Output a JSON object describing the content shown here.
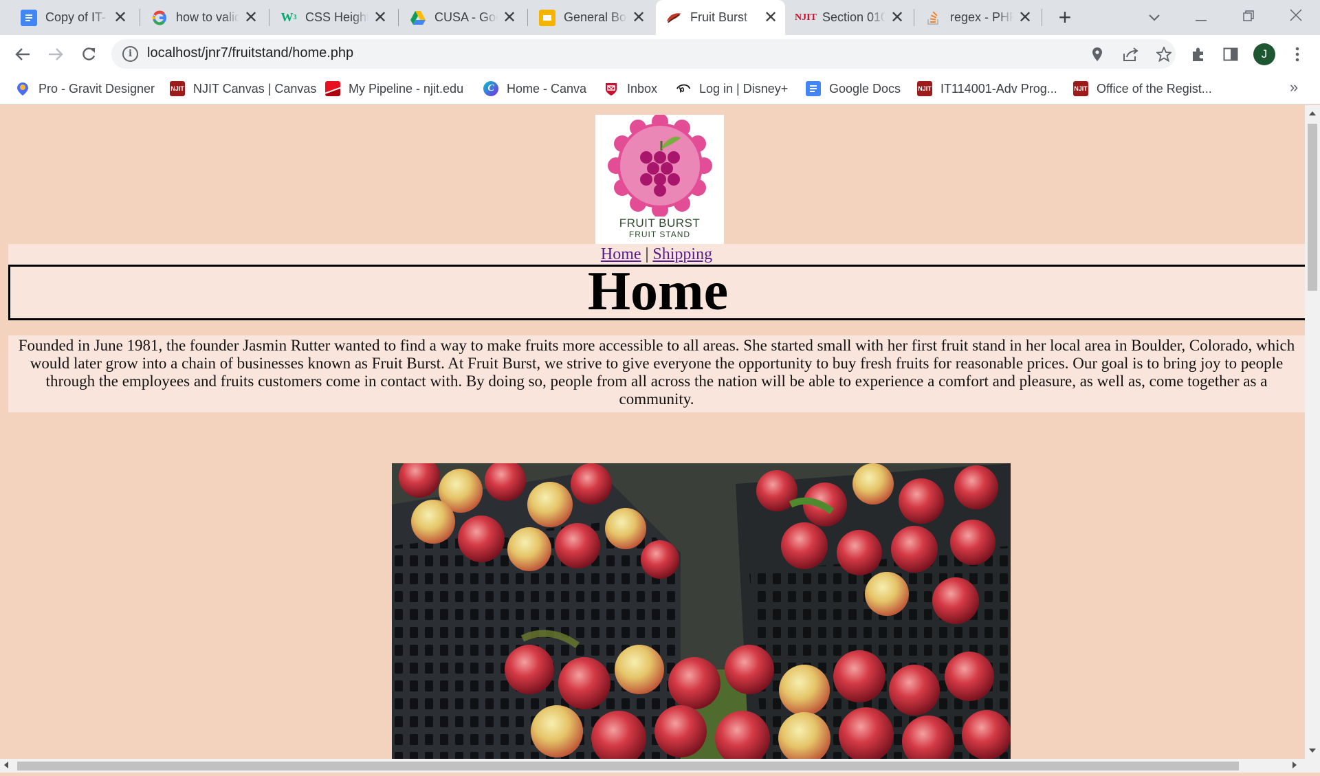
{
  "browser": {
    "tabs": [
      {
        "title": "Copy of IT-",
        "icon": "google-docs-icon",
        "active": false
      },
      {
        "title": "how to valid",
        "icon": "google-icon",
        "active": false
      },
      {
        "title": "CSS Height,",
        "icon": "w3schools-icon",
        "active": false
      },
      {
        "title": "CUSA - Goo",
        "icon": "google-drive-icon",
        "active": false
      },
      {
        "title": "General Boo",
        "icon": "google-slides-icon",
        "active": false
      },
      {
        "title": "Fruit Burst",
        "icon": "fruit-burst-icon",
        "active": true
      },
      {
        "title": "Section 010",
        "icon": "njit-icon",
        "active": false
      },
      {
        "title": "regex - PHP",
        "icon": "stack-overflow-icon",
        "active": false
      }
    ],
    "close_glyph": "✕",
    "new_tab_glyph": "+",
    "url": "localhost/jnr7/fruitstand/home.php",
    "profile_initial": "J",
    "bookmarks": [
      {
        "label": "Pro - Gravit Designer",
        "icon": "gravit-icon"
      },
      {
        "label": "NJIT Canvas | Canvas",
        "icon": "njit-icon"
      },
      {
        "label": "My Pipeline - njit.edu",
        "icon": "pipeline-icon"
      },
      {
        "label": "Home - Canva",
        "icon": "canva-icon"
      },
      {
        "label": "Inbox",
        "icon": "mail-icon"
      },
      {
        "label": "Log in | Disney+",
        "icon": "disney-plus-icon"
      },
      {
        "label": "Google Docs",
        "icon": "google-docs-icon"
      },
      {
        "label": "IT114001-Adv Prog...",
        "icon": "njit-icon"
      },
      {
        "label": "Office of the Regist...",
        "icon": "njit-icon"
      }
    ],
    "bookmarks_more": "»"
  },
  "page": {
    "logo": {
      "line1": "FRUIT BURST",
      "line2": "FRUIT STAND"
    },
    "nav": {
      "home": "Home",
      "separator": " | ",
      "shipping": "Shipping"
    },
    "heading": "Home",
    "intro": "Founded in June 1981, the founder Jasmin Rutter wanted to find a way to make fruits more accessible to all areas. She started small with her first fruit stand in her local area in Boulder, Colorado, which would later grow into a chain of businesses known as Fruit Burst. At Fruit Burst, we strive to give everyone the opportunity to buy fresh fruits for reasonable prices. Our goal is to bring joy to people through the employees and fruits customers come in contact with. By doing so, people from all across the nation will be able to experience a comfort and pleasure, as well as, come together as a community.",
    "photo": "apples-in-crates-photo"
  },
  "colors": {
    "page_background": "#f3d3bd",
    "section_background": "#fae5dc",
    "link": "#551a8b",
    "logo_petals": "#d64a90",
    "logo_grapes": "#a8166b",
    "logo_leaf": "#6a9b3a"
  }
}
